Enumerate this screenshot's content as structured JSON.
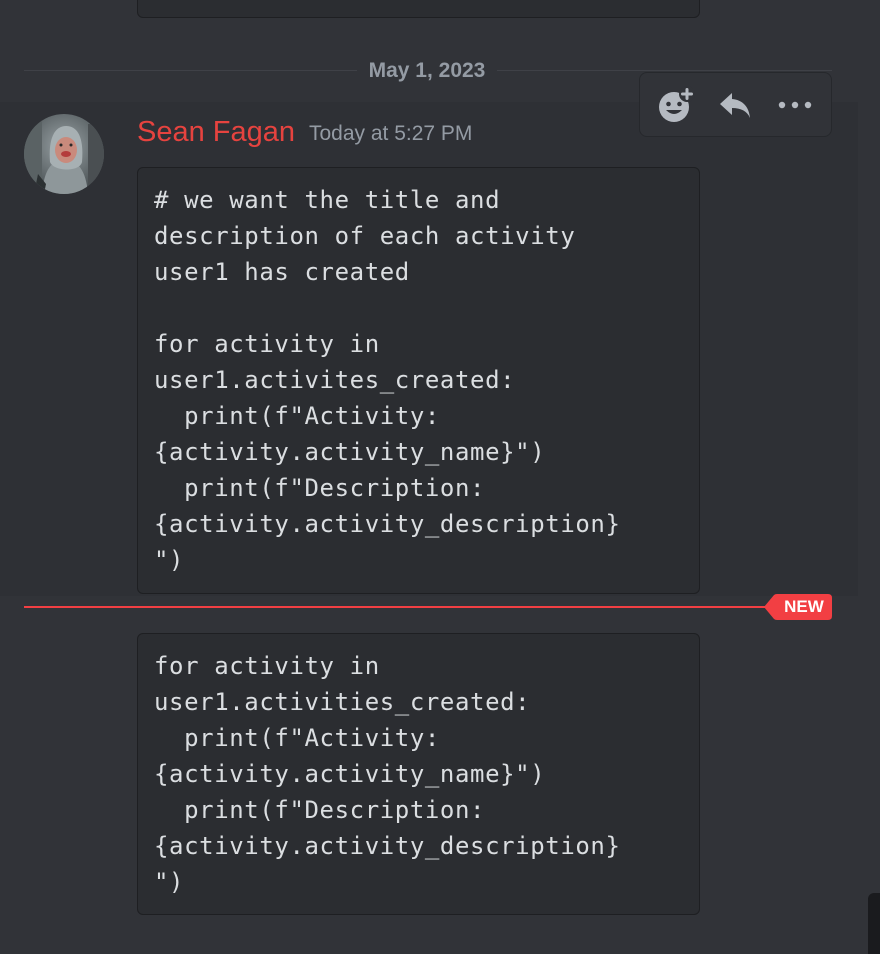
{
  "date_divider": {
    "label": "May 1, 2023"
  },
  "toolbar": {
    "buttons": [
      {
        "icon": "add-reaction-icon"
      },
      {
        "icon": "reply-icon"
      },
      {
        "icon": "more-icon"
      }
    ]
  },
  "message": {
    "author": "Sean Fagan",
    "author_color": "#e6433f",
    "timestamp": "Today at 5:27 PM",
    "code": "# we want the title and\ndescription of each activity\nuser1 has created\n\nfor activity in\nuser1.activites_created:\n  print(f\"Activity:\n{activity.activity_name}\")\n  print(f\"Description:\n{activity.activity_description}\n\")"
  },
  "new_divider": {
    "label": "NEW",
    "color": "#f23f43"
  },
  "followup_message": {
    "code": "for activity in\nuser1.activities_created:\n  print(f\"Activity:\n{activity.activity_name}\")\n  print(f\"Description:\n{activity.activity_description}\n\")"
  }
}
